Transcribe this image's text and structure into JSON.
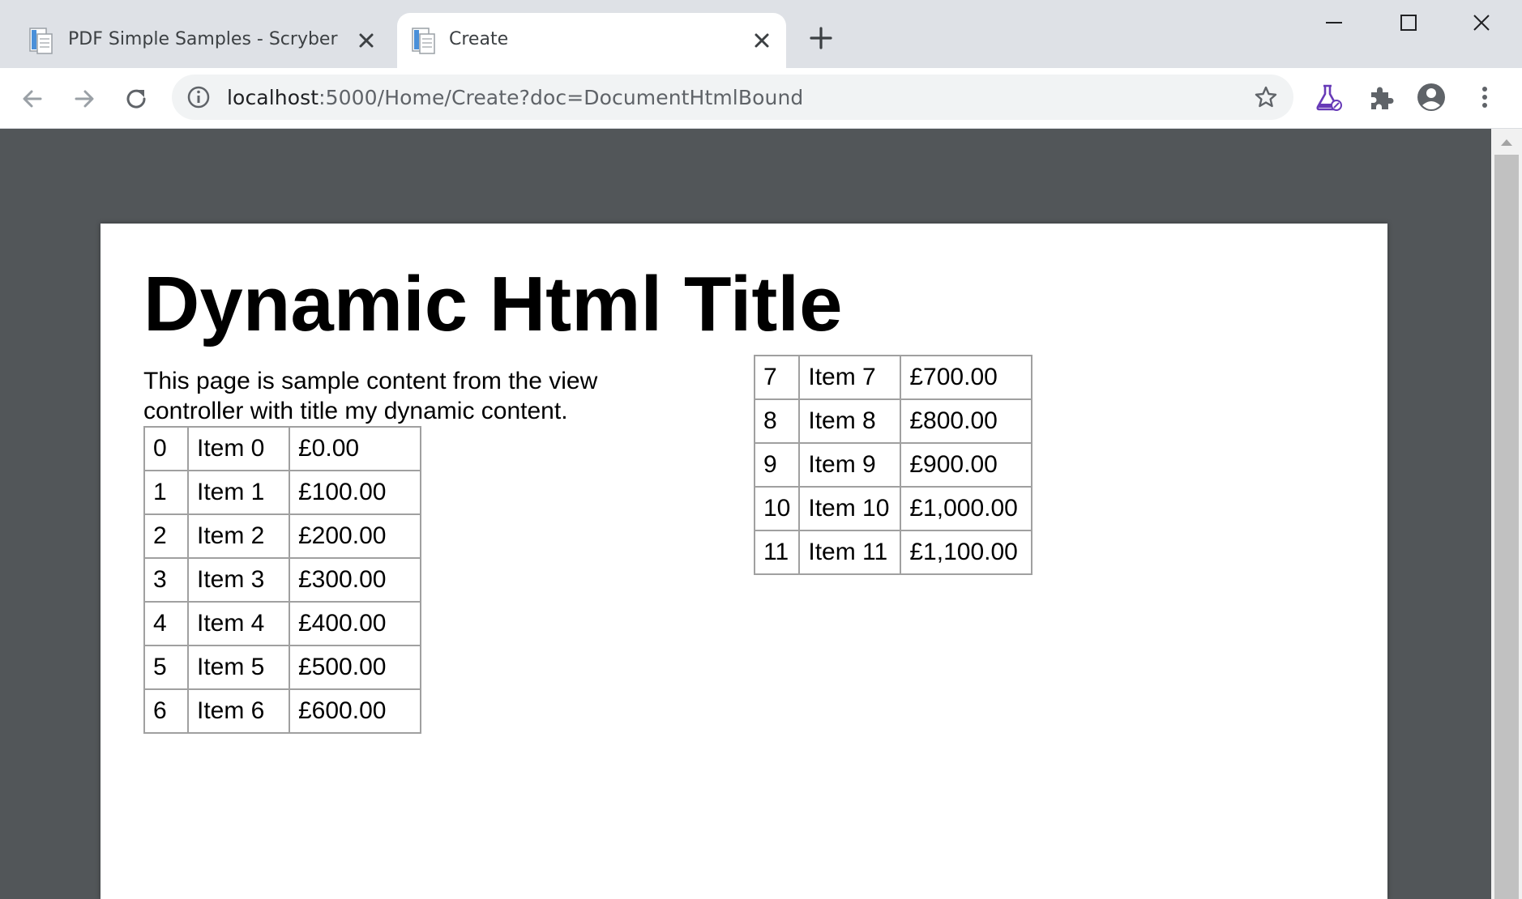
{
  "browser": {
    "tabs": [
      {
        "title": "PDF Simple Samples - Scryber",
        "active": false
      },
      {
        "title": "Create",
        "active": true
      }
    ],
    "url_host": "localhost",
    "url_rest": ":5000/Home/Create?doc=DocumentHtmlBound"
  },
  "document": {
    "title": "Dynamic Html Title",
    "paragraph": "This page is sample content from the view controller with title my dynamic content.",
    "table_left": [
      [
        "0",
        "Item 0",
        "£0.00"
      ],
      [
        "1",
        "Item 1",
        "£100.00"
      ],
      [
        "2",
        "Item 2",
        "£200.00"
      ],
      [
        "3",
        "Item 3",
        "£300.00"
      ],
      [
        "4",
        "Item 4",
        "£400.00"
      ],
      [
        "5",
        "Item 5",
        "£500.00"
      ],
      [
        "6",
        "Item 6",
        "£600.00"
      ]
    ],
    "table_right": [
      [
        "7",
        "Item 7",
        "£700.00"
      ],
      [
        "8",
        "Item 8",
        "£800.00"
      ],
      [
        "9",
        "Item 9",
        "£900.00"
      ],
      [
        "10",
        "Item 10",
        "£1,000.00"
      ],
      [
        "11",
        "Item 11",
        "£1,100.00"
      ]
    ]
  },
  "icons": {
    "tab_favicon": "document-icon",
    "tab_close": "close-icon",
    "new_tab": "plus-icon",
    "back": "arrow-left-icon",
    "forward": "arrow-right-icon",
    "reload": "reload-icon",
    "site_info": "info-icon",
    "bookmark": "star-icon",
    "labs": "flask-icon",
    "extensions": "puzzle-icon",
    "profile": "account-circle-icon",
    "menu": "more-vert-icon"
  },
  "colors": {
    "tabstrip_bg": "#dee1e6",
    "viewer_bg": "#525659",
    "page_bg": "#ffffff",
    "labs_accent": "#673ab7"
  }
}
